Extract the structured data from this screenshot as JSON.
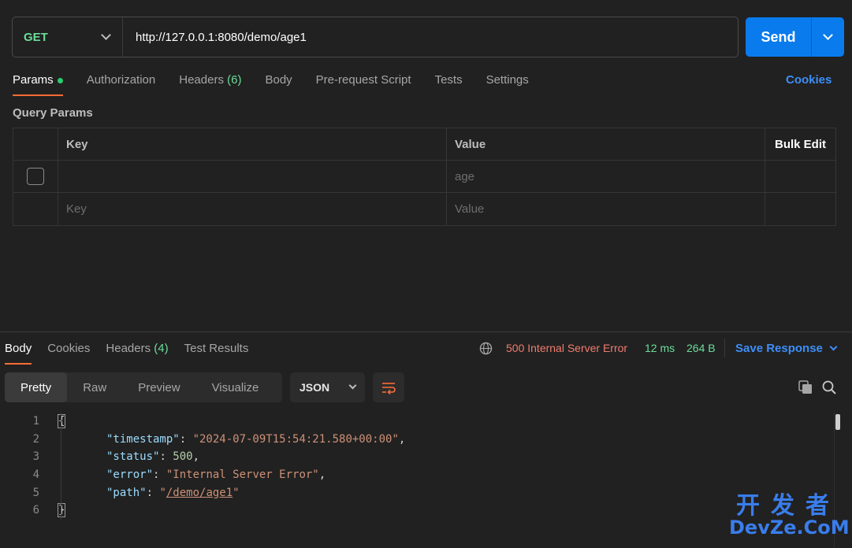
{
  "request": {
    "method": "GET",
    "url": "http://127.0.0.1:8080/demo/age1",
    "send_label": "Send"
  },
  "request_tabs": [
    {
      "label": "Params",
      "active": true,
      "dot": true
    },
    {
      "label": "Authorization"
    },
    {
      "label": "Headers",
      "count": "(6)"
    },
    {
      "label": "Body"
    },
    {
      "label": "Pre-request Script"
    },
    {
      "label": "Tests"
    },
    {
      "label": "Settings"
    }
  ],
  "cookies_label": "Cookies",
  "query_params": {
    "title": "Query Params",
    "headers": {
      "key": "Key",
      "value": "Value",
      "bulk_edit": "Bulk Edit"
    },
    "rows": [
      {
        "key": "",
        "value": "age"
      },
      {
        "key": "Key",
        "value": "Value"
      }
    ]
  },
  "response": {
    "tabs": [
      {
        "label": "Body",
        "active": true
      },
      {
        "label": "Cookies"
      },
      {
        "label": "Headers",
        "count": "(4)"
      },
      {
        "label": "Test Results"
      }
    ],
    "status": "500 Internal Server Error",
    "time": "12 ms",
    "size": "264 B",
    "save_label": "Save Response",
    "view_modes": [
      "Pretty",
      "Raw",
      "Preview",
      "Visualize"
    ],
    "active_view": "Pretty",
    "format": "JSON",
    "body_lines": [
      {
        "n": "1",
        "text": "{"
      },
      {
        "n": "2",
        "key": "\"timestamp\"",
        "val": "\"2024-07-09T15:54:21.580+00:00\"",
        "type": "str"
      },
      {
        "n": "3",
        "key": "\"status\"",
        "val": "500",
        "type": "num"
      },
      {
        "n": "4",
        "key": "\"error\"",
        "val": "\"Internal Server Error\"",
        "type": "str"
      },
      {
        "n": "5",
        "key": "\"path\"",
        "val_open": "\"",
        "val_link": "/demo/age1",
        "val_close": "\"",
        "type": "link"
      },
      {
        "n": "6",
        "text": "}"
      }
    ]
  },
  "watermark": {
    "line1": "开发者",
    "line2": "DevZe.CoM"
  },
  "colors": {
    "accent": "#ff6c37",
    "send": "#097bed",
    "method": "#6bdd9a",
    "error": "#f27c6f",
    "link": "#3d8ef7"
  }
}
